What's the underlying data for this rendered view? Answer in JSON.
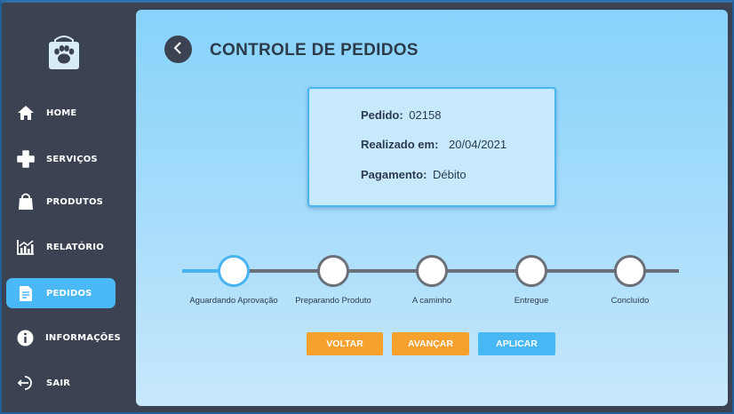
{
  "sidebar": {
    "logo_icon": "paw-bag-icon",
    "items": [
      {
        "label": "HOME",
        "icon": "home-icon"
      },
      {
        "label": "SERVIÇOS",
        "icon": "plus-icon"
      },
      {
        "label": "PRODUTOS",
        "icon": "shopping-bag-icon"
      },
      {
        "label": "RELATÓRIO",
        "icon": "chart-icon"
      },
      {
        "label": "PEDIDOS",
        "icon": "document-icon",
        "active": true
      },
      {
        "label": "INFORMAÇÕES",
        "icon": "info-icon"
      },
      {
        "label": "SAIR",
        "icon": "logout-icon"
      }
    ]
  },
  "header": {
    "title": "CONTROLE DE PEDIDOS",
    "back_icon": "chevron-left-icon"
  },
  "order": {
    "id_label": "Pedido:",
    "id_value": "02158",
    "date_label": "Realizado em:",
    "date_value": "20/04/2021",
    "payment_label": "Pagamento:",
    "payment_value": "Débito"
  },
  "progress": {
    "current_step": 1,
    "steps": [
      {
        "label": "Aguardando Aprovação"
      },
      {
        "label": "Preparando Produto"
      },
      {
        "label": "A caminho"
      },
      {
        "label": "Entregue"
      },
      {
        "label": "Concluído"
      }
    ]
  },
  "actions": {
    "back_label": "VOLTAR",
    "next_label": "AVANÇAR",
    "apply_label": "APLICAR"
  },
  "colors": {
    "sidebar_bg": "#3b4352",
    "accent_blue": "#47b3ef",
    "orange": "#f6a02e"
  }
}
